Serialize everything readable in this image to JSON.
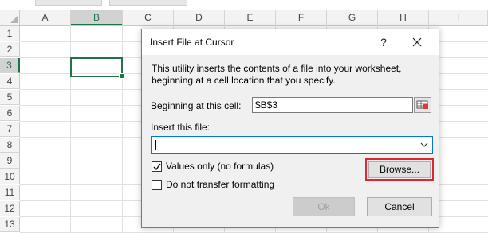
{
  "sheet": {
    "columns": [
      "A",
      "B",
      "C",
      "D",
      "E",
      "F",
      "G",
      "H",
      "I"
    ],
    "rows": [
      "1",
      "2",
      "3",
      "4",
      "5",
      "6",
      "7",
      "8",
      "9",
      "10",
      "11",
      "12",
      "13"
    ],
    "selected_column": "B",
    "selected_row": "3"
  },
  "dialog": {
    "title": "Insert File at Cursor",
    "help_label": "?",
    "description": "This utility inserts the contents of a file into your worksheet, beginning at a cell location that you specify.",
    "start_label": "Beginning at this cell:",
    "start_value": "$B$3",
    "file_label": "Insert this file:",
    "file_value": "",
    "values_only_label": "Values only (no formulas)",
    "values_only_checked": true,
    "no_format_label": "Do not transfer formatting",
    "no_format_checked": false,
    "browse_label": "Browse...",
    "ok_label": "Ok",
    "cancel_label": "Cancel"
  },
  "colors": {
    "accent": "#217346",
    "highlight": "#e0262c",
    "focus": "#0078d7"
  }
}
